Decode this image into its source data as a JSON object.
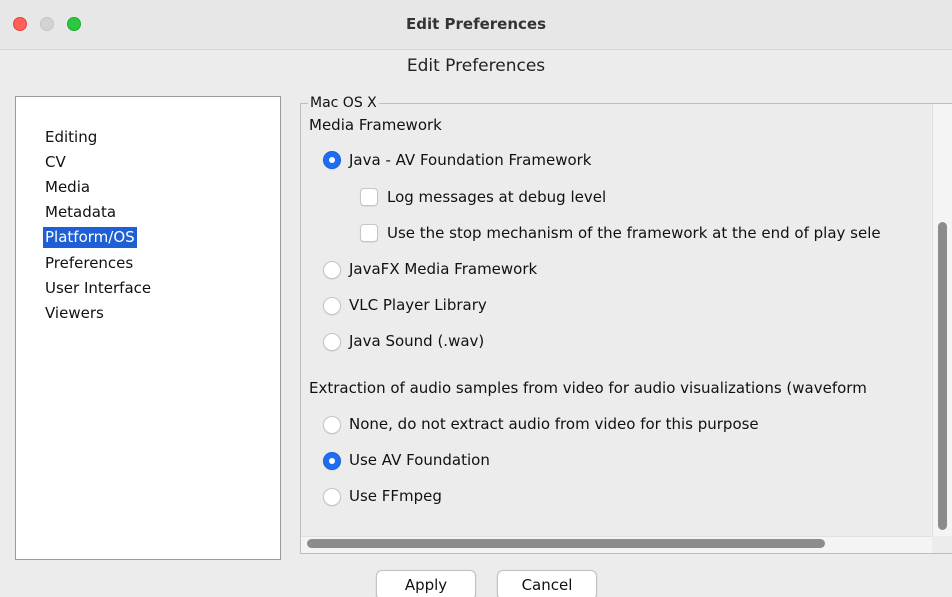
{
  "window": {
    "title": "Edit Preferences"
  },
  "heading": "Edit Preferences",
  "sidebar": {
    "items": [
      {
        "label": "Editing",
        "selected": false
      },
      {
        "label": "CV",
        "selected": false
      },
      {
        "label": "Media",
        "selected": false
      },
      {
        "label": "Metadata",
        "selected": false
      },
      {
        "label": "Platform/OS",
        "selected": true
      },
      {
        "label": "Preferences",
        "selected": false
      },
      {
        "label": "User Interface",
        "selected": false
      },
      {
        "label": "Viewers",
        "selected": false
      }
    ]
  },
  "panel": {
    "title": "Mac OS X",
    "media_framework": {
      "label": "Media Framework",
      "options": [
        {
          "label": "Java - AV Foundation Framework",
          "checked": true
        },
        {
          "label": "JavaFX Media Framework",
          "checked": false
        },
        {
          "label": "VLC Player Library",
          "checked": false
        },
        {
          "label": "Java Sound (.wav)",
          "checked": false
        }
      ],
      "sub_options": [
        {
          "label": "Log messages at debug level",
          "checked": false
        },
        {
          "label": "Use the stop mechanism of the framework at the end of play sele",
          "checked": false
        }
      ]
    },
    "extraction": {
      "label": "Extraction of audio samples from video for audio visualizations (waveform",
      "options": [
        {
          "label": "None, do not extract audio from video for this purpose",
          "checked": false
        },
        {
          "label": "Use AV Foundation",
          "checked": true
        },
        {
          "label": "Use FFmpeg",
          "checked": false
        }
      ]
    }
  },
  "buttons": {
    "apply": "Apply",
    "cancel": "Cancel"
  },
  "colors": {
    "selection": "#1f5fd6",
    "radio_checked": "#1e6ef2"
  }
}
